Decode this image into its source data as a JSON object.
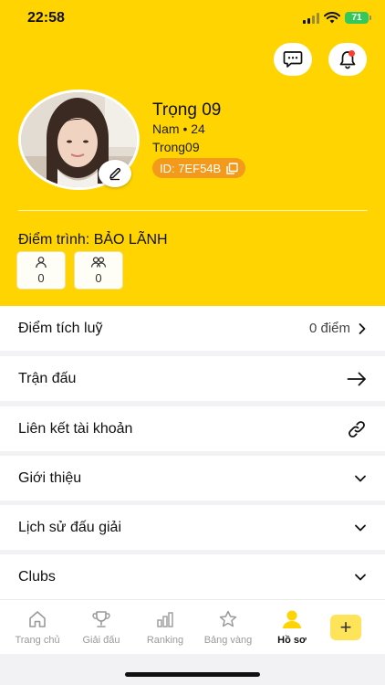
{
  "status_bar": {
    "time": "22:58",
    "battery": "71"
  },
  "profile": {
    "name": "Trọng 09",
    "gender_age": "Nam • 24",
    "username": "Trong09",
    "id_label": "ID: 7EF54B"
  },
  "rank": {
    "label": "Điểm trình: BẢO LÃNH",
    "stats": [
      {
        "icon": "single-user-icon",
        "value": "0"
      },
      {
        "icon": "group-users-icon",
        "value": "0"
      }
    ]
  },
  "menu": {
    "points_label": "Điểm tích luỹ",
    "points_value": "0 điểm",
    "matches_label": "Trận đấu",
    "link_account_label": "Liên kết tài khoản",
    "intro_label": "Giới thiệu",
    "tournament_history_label": "Lịch sử đấu giải",
    "clubs_label": "Clubs"
  },
  "tabs": [
    {
      "label": "Trang chủ",
      "icon": "home-icon"
    },
    {
      "label": "Giải đấu",
      "icon": "trophy-icon"
    },
    {
      "label": "Ranking",
      "icon": "bar-chart-icon"
    },
    {
      "label": "Bảng vàng",
      "icon": "star-icon"
    },
    {
      "label": "Hồ sơ",
      "icon": "profile-icon",
      "active": true
    }
  ],
  "add_button": "+",
  "colors": {
    "primary": "#ffd400",
    "id_chip": "#f39a1b",
    "notification_dot": "#ff3b30",
    "battery": "#34c759"
  }
}
